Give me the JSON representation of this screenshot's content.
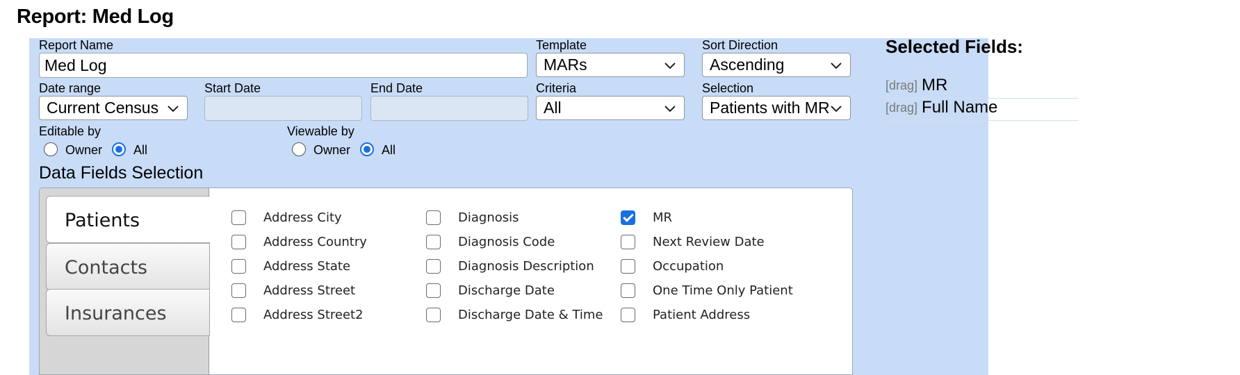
{
  "page": {
    "title": "Report: Med Log"
  },
  "form": {
    "report_name_label": "Report Name",
    "report_name_value": "Med Log",
    "template_label": "Template",
    "template_value": "MARs",
    "sort_direction_label": "Sort Direction",
    "sort_direction_value": "Ascending",
    "date_range_label": "Date range",
    "date_range_value": "Current Census",
    "start_date_label": "Start Date",
    "start_date_value": "",
    "end_date_label": "End Date",
    "end_date_value": "",
    "criteria_label": "Criteria",
    "criteria_value": "All",
    "selection_label": "Selection",
    "selection_value": "Patients with MR",
    "editable_by": {
      "label": "Editable by",
      "owner_label": "Owner",
      "all_label": "All",
      "selected": "All"
    },
    "viewable_by": {
      "label": "Viewable by",
      "owner_label": "Owner",
      "all_label": "All",
      "selected": "All"
    }
  },
  "data_fields": {
    "title": "Data Fields Selection",
    "tabs": [
      {
        "label": "Patients",
        "active": true
      },
      {
        "label": "Contacts",
        "active": false
      },
      {
        "label": "Insurances",
        "active": false
      }
    ],
    "columns": [
      [
        {
          "label": "Address City",
          "checked": false
        },
        {
          "label": "Address Country",
          "checked": false
        },
        {
          "label": "Address State",
          "checked": false
        },
        {
          "label": "Address Street",
          "checked": false
        },
        {
          "label": "Address Street2",
          "checked": false
        }
      ],
      [
        {
          "label": "Diagnosis",
          "checked": false
        },
        {
          "label": "Diagnosis Code",
          "checked": false
        },
        {
          "label": "Diagnosis Description",
          "checked": false
        },
        {
          "label": "Discharge Date",
          "checked": false
        },
        {
          "label": "Discharge Date & Time",
          "checked": false
        }
      ],
      [
        {
          "label": "MR",
          "checked": true
        },
        {
          "label": "Next Review Date",
          "checked": false
        },
        {
          "label": "Occupation",
          "checked": false
        },
        {
          "label": "One Time Only Patient",
          "checked": false
        },
        {
          "label": "Patient Address",
          "checked": false
        }
      ]
    ]
  },
  "selected_fields": {
    "title": "Selected Fields:",
    "drag_label": "[drag]",
    "items": [
      "MR",
      "Full Name"
    ]
  },
  "colors": {
    "panel_bg": "#c8dcf7",
    "accent": "#1a6fe0"
  },
  "icons": {
    "select_arrow": "chevron-down-icon",
    "checked_mark": "checkmark-icon"
  }
}
